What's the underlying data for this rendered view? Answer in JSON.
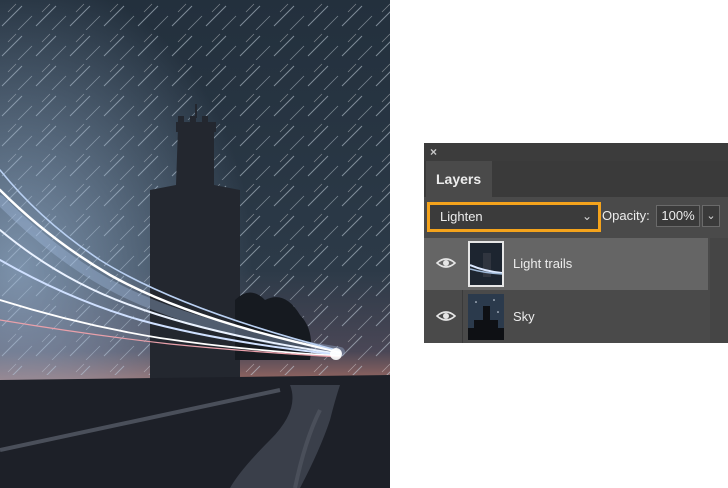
{
  "panel": {
    "close_icon": "×",
    "tab_label": "Layers",
    "blend_mode": "Lighten",
    "opacity_label": "Opacity:",
    "opacity_value": "100%",
    "highlight_color": "#f4a31c"
  },
  "layers": [
    {
      "name": "Light trails",
      "visible": true,
      "selected": true
    },
    {
      "name": "Sky",
      "visible": true,
      "selected": false
    }
  ]
}
